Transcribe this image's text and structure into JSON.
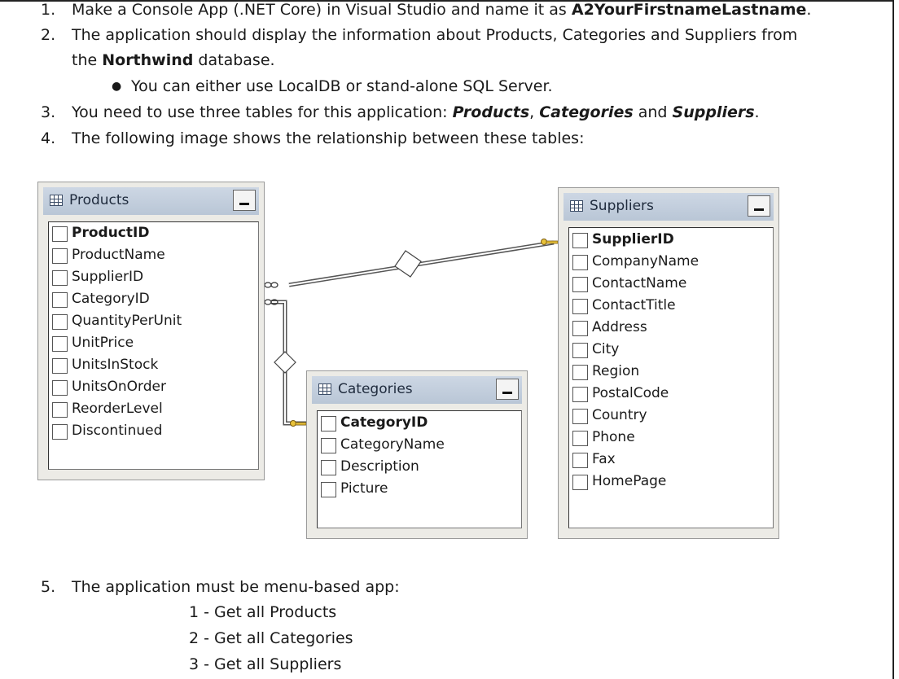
{
  "list_items": [
    {
      "num": "1.",
      "parts": [
        {
          "t": "Make a Console App (.NET Core) in Visual Studio and name it as "
        },
        {
          "t": "A2YourFirstnameLastname",
          "s": "b"
        },
        {
          "t": "."
        }
      ]
    },
    {
      "num": "2.",
      "parts": [
        {
          "t": "The application should display the information about Products, Categories and Suppliers from"
        }
      ]
    },
    {
      "num": "",
      "parts": [
        {
          "t": "the "
        },
        {
          "t": "Northwind",
          "s": "b"
        },
        {
          "t": " database."
        }
      ]
    },
    {
      "num": "3.",
      "parts": [
        {
          "t": "You need to use three tables for this application: "
        },
        {
          "t": "Products",
          "s": "bi"
        },
        {
          "t": ", "
        },
        {
          "t": "Categories",
          "s": "bi"
        },
        {
          "t": " and "
        },
        {
          "t": "Suppliers",
          "s": "bi"
        },
        {
          "t": "."
        }
      ]
    },
    {
      "num": "4.",
      "parts": [
        {
          "t": "The following image shows the relationship between these tables:"
        }
      ]
    }
  ],
  "bullet": {
    "symbol": "●",
    "text": "You can either use LocalDB or stand-alone SQL Server."
  },
  "diagram": {
    "tables": [
      {
        "id": "products",
        "name": "Products",
        "columns": [
          "ProductID",
          "ProductName",
          "SupplierID",
          "CategoryID",
          "QuantityPerUnit",
          "UnitPrice",
          "UnitsInStock",
          "UnitsOnOrder",
          "ReorderLevel",
          "Discontinued"
        ],
        "primary_key": "ProductID"
      },
      {
        "id": "categories",
        "name": "Categories",
        "columns": [
          "CategoryID",
          "CategoryName",
          "Description",
          "Picture"
        ],
        "primary_key": "CategoryID"
      },
      {
        "id": "suppliers",
        "name": "Suppliers",
        "columns": [
          "SupplierID",
          "CompanyName",
          "ContactName",
          "ContactTitle",
          "Address",
          "City",
          "Region",
          "PostalCode",
          "Country",
          "Phone",
          "Fax",
          "HomePage"
        ],
        "primary_key": "SupplierID"
      }
    ],
    "relationships": [
      {
        "from": "products",
        "to": "suppliers",
        "from_end": "infinity",
        "to_end": "key"
      },
      {
        "from": "products",
        "to": "categories",
        "from_end": "infinity",
        "to_end": "key"
      }
    ]
  },
  "step5": {
    "num": "5.",
    "text": "The application must be menu-based app:"
  },
  "menu_items": [
    "1 - Get all Products",
    "2 - Get all Categories",
    "3 - Get all Suppliers"
  ]
}
